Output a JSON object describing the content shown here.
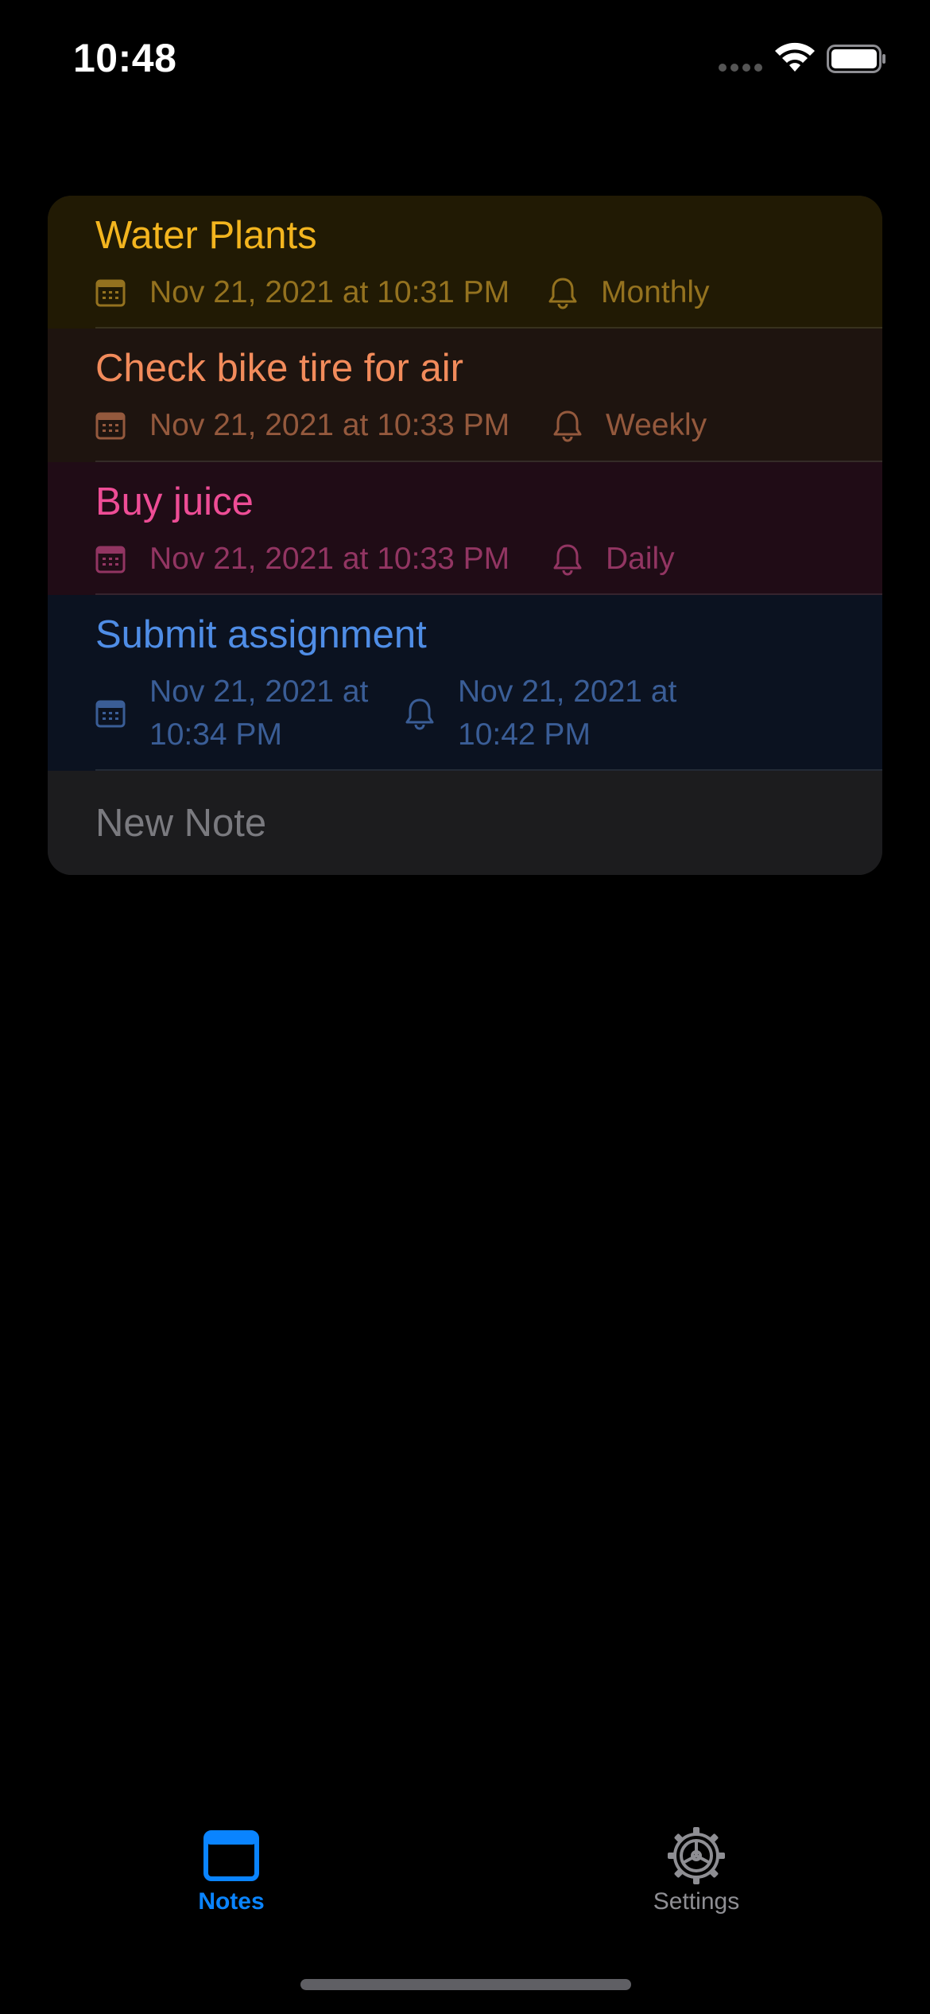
{
  "status_bar": {
    "time": "10:48",
    "icons": [
      "cellular-signal-icon",
      "wifi-icon",
      "battery-icon"
    ]
  },
  "notes": [
    {
      "title": "Water Plants",
      "date": "Nov 21, 2021 at 10:31 PM",
      "reminder": "Monthly",
      "title_color": "#f3b51f",
      "meta_color": "#94721f",
      "row_color": "#211a04"
    },
    {
      "title": "Check bike tire for air",
      "date": "Nov 21, 2021 at 10:33 PM",
      "reminder": "Weekly",
      "title_color": "#f28b5b",
      "meta_color": "#94593d",
      "row_color": "#1e140f"
    },
    {
      "title": "Buy juice",
      "date": "Nov 21, 2021 at 10:33 PM",
      "reminder": "Daily",
      "title_color": "#ee4d96",
      "meta_color": "#923562",
      "row_color": "#200c16"
    },
    {
      "title": "Submit assignment",
      "date": "Nov 21, 2021 at 10:34 PM",
      "reminder": "Nov 21, 2021 at 10:42 PM",
      "title_color": "#4f8de6",
      "meta_color": "#3a5d96",
      "row_color": "#0b1220"
    }
  ],
  "new_note": {
    "placeholder": "New Note"
  },
  "tab_bar": {
    "tabs": [
      {
        "label": "Notes",
        "icon": "notes-window-icon",
        "selected": true
      },
      {
        "label": "Settings",
        "icon": "gear-icon",
        "selected": false
      }
    ],
    "active_color": "#0a84ff",
    "inactive_color": "#8e8e93"
  }
}
